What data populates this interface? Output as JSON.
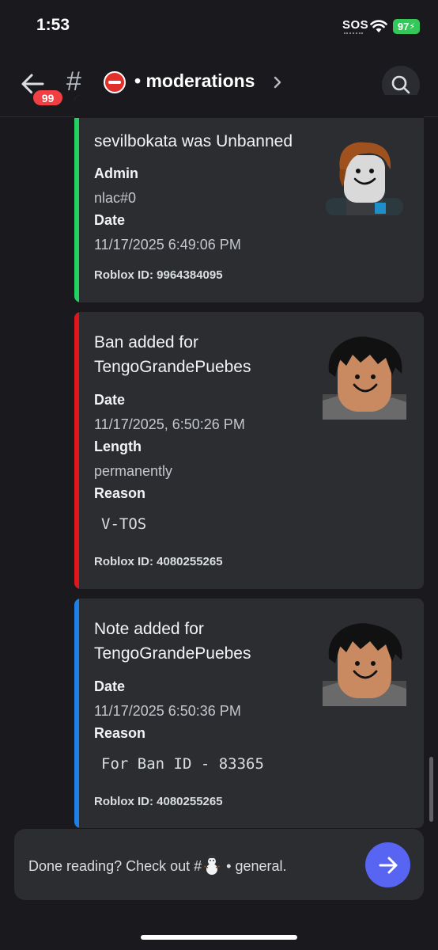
{
  "status_bar": {
    "time": "1:53",
    "sos": "SOS",
    "battery": "97"
  },
  "header": {
    "unread_badge": "99",
    "hash": "#",
    "channel_name": "• moderations",
    "icons": [
      "back-arrow-icon",
      "hash-icon",
      "no-entry-icon",
      "chevron-right-icon",
      "search-icon"
    ]
  },
  "embeds": [
    {
      "accent_color": "#23d160",
      "title": "sevilbokata was Unbanned",
      "fields": [
        {
          "name": "Admin",
          "value": "nlac#0"
        },
        {
          "name": "Date",
          "value": "11/17/2025 6:49:06 PM"
        }
      ],
      "footer": "Roblox ID: 9964384095"
    },
    {
      "accent_color": "#e0161b",
      "title_line1": "Ban added for",
      "title_line2": "TengoGrandePuebes",
      "fields": [
        {
          "name": "Date",
          "value": "11/17/2025, 6:50:26 PM"
        },
        {
          "name": "Length",
          "value": "permanently"
        },
        {
          "name": "Reason",
          "value": "V-TOS"
        }
      ],
      "footer": "Roblox ID: 4080255265"
    },
    {
      "accent_color": "#1e7fe6",
      "title_line1": "Note added for",
      "title_line2": "TengoGrandePuebes",
      "fields": [
        {
          "name": "Date",
          "value": "11/17/2025 6:50:36 PM"
        },
        {
          "name": "Reason",
          "value": "For Ban ID - 83365"
        }
      ],
      "footer": "Roblox ID: 4080255265"
    }
  ],
  "banner": {
    "text_before": "Done reading? Check out #",
    "text_after": " • general.",
    "icons": [
      "snowman-icon",
      "arrow-right-icon"
    ]
  },
  "colors": {
    "background": "#1a1a1e",
    "embed_bg": "#2b2d31",
    "accent_button": "#5865f2",
    "badge": "#f23f43"
  }
}
